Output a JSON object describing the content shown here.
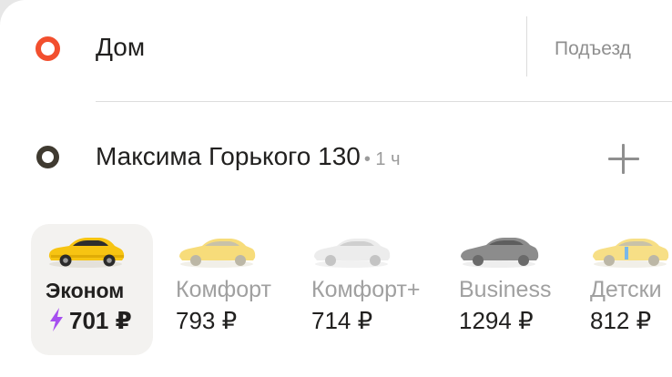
{
  "route": {
    "from": {
      "address": "Дом",
      "entrance_label": "Подъезд",
      "marker_color": "#f24f2e"
    },
    "to": {
      "address": "Максима Горького 130",
      "eta": "• 1 ч",
      "marker_color": "#3f3a30"
    }
  },
  "tariffs": [
    {
      "name": "Эконом",
      "price": "701 ₽",
      "selected": true,
      "car_color": "#f7c412",
      "surge_icon": "lightning-icon",
      "surge_color": "#a64ff0"
    },
    {
      "name": "Комфорт",
      "price": "793 ₽",
      "selected": false,
      "car_color": "#f7dc7a"
    },
    {
      "name": "Комфорт+",
      "price": "714 ₽",
      "selected": false,
      "car_color": "#ececec"
    },
    {
      "name": "Business",
      "price": "1294 ₽",
      "selected": false,
      "car_color": "#8c8c8c"
    },
    {
      "name": "Детски",
      "price": "812 ₽",
      "selected": false,
      "car_color": "#f7df86"
    }
  ]
}
